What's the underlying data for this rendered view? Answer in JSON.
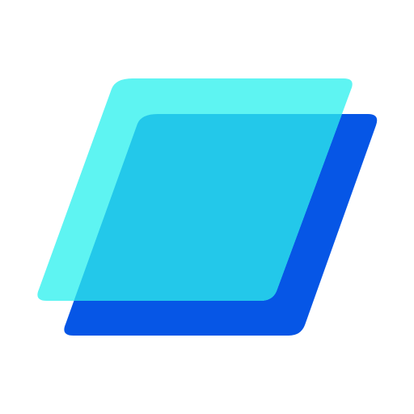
{
  "logo": {
    "icon": "layered-parallelogram-logo-icon",
    "colors": {
      "background": "#ffffff",
      "back_shape": "#0656E6",
      "front_shape": "#5EF4F2",
      "overlap": "#23C8EA"
    }
  }
}
